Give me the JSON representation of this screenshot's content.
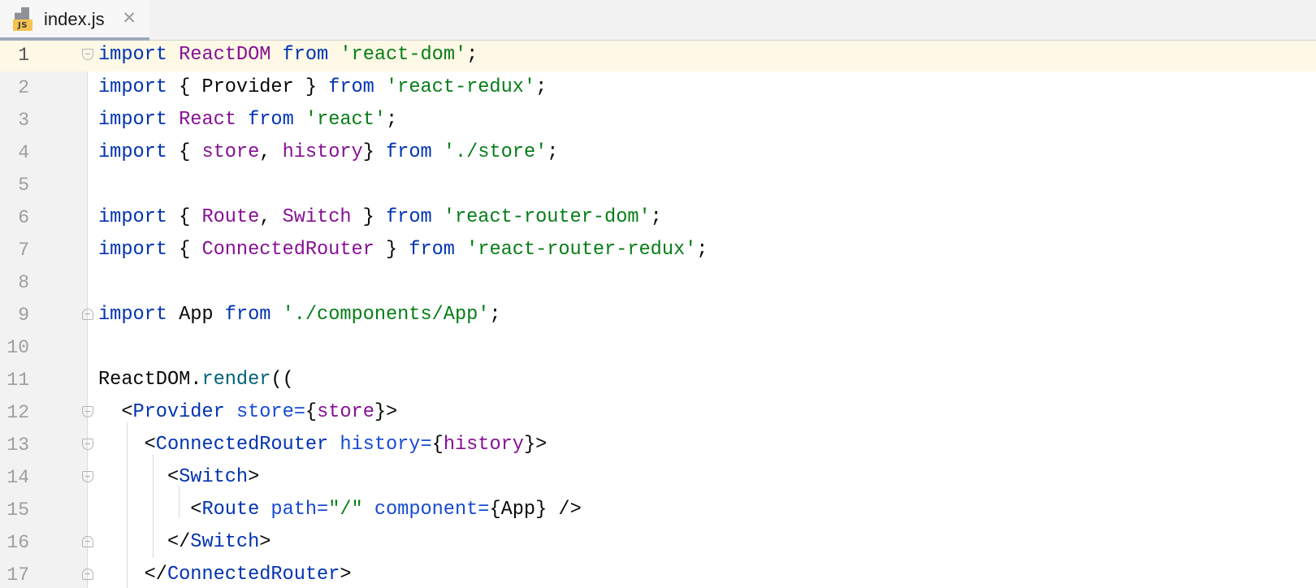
{
  "tab": {
    "icon_badge": "JS",
    "title": "index.js",
    "close_glyph": "✕"
  },
  "editor": {
    "current_line": 1,
    "lines": [
      {
        "number": "1",
        "fold": "open",
        "tokens": [
          [
            "kw",
            "import"
          ],
          [
            "plain",
            " "
          ],
          [
            "imp",
            "ReactDOM"
          ],
          [
            "plain",
            " "
          ],
          [
            "kw",
            "from"
          ],
          [
            "plain",
            " "
          ],
          [
            "str",
            "'react-dom'"
          ],
          [
            "plain",
            ";"
          ]
        ]
      },
      {
        "number": "2",
        "fold": "",
        "tokens": [
          [
            "kw",
            "import"
          ],
          [
            "plain",
            " { Provider } "
          ],
          [
            "kw",
            "from"
          ],
          [
            "plain",
            " "
          ],
          [
            "str",
            "'react-redux'"
          ],
          [
            "plain",
            ";"
          ]
        ]
      },
      {
        "number": "3",
        "fold": "",
        "tokens": [
          [
            "kw",
            "import"
          ],
          [
            "plain",
            " "
          ],
          [
            "imp",
            "React"
          ],
          [
            "plain",
            " "
          ],
          [
            "kw",
            "from"
          ],
          [
            "plain",
            " "
          ],
          [
            "str",
            "'react'"
          ],
          [
            "plain",
            ";"
          ]
        ]
      },
      {
        "number": "4",
        "fold": "",
        "tokens": [
          [
            "kw",
            "import"
          ],
          [
            "plain",
            " { "
          ],
          [
            "imp",
            "store"
          ],
          [
            "plain",
            ", "
          ],
          [
            "imp",
            "history"
          ],
          [
            "plain",
            "} "
          ],
          [
            "kw",
            "from"
          ],
          [
            "plain",
            " "
          ],
          [
            "str",
            "'./store'"
          ],
          [
            "plain",
            ";"
          ]
        ]
      },
      {
        "number": "5",
        "fold": "",
        "tokens": []
      },
      {
        "number": "6",
        "fold": "",
        "tokens": [
          [
            "kw",
            "import"
          ],
          [
            "plain",
            " { "
          ],
          [
            "imp",
            "Route"
          ],
          [
            "plain",
            ", "
          ],
          [
            "imp",
            "Switch"
          ],
          [
            "plain",
            " } "
          ],
          [
            "kw",
            "from"
          ],
          [
            "plain",
            " "
          ],
          [
            "str",
            "'react-router-dom'"
          ],
          [
            "plain",
            ";"
          ]
        ]
      },
      {
        "number": "7",
        "fold": "",
        "tokens": [
          [
            "kw",
            "import"
          ],
          [
            "plain",
            " { "
          ],
          [
            "imp",
            "ConnectedRouter"
          ],
          [
            "plain",
            " } "
          ],
          [
            "kw",
            "from"
          ],
          [
            "plain",
            " "
          ],
          [
            "str",
            "'react-router-redux'"
          ],
          [
            "plain",
            ";"
          ]
        ]
      },
      {
        "number": "8",
        "fold": "",
        "tokens": []
      },
      {
        "number": "9",
        "fold": "close",
        "tokens": [
          [
            "kw",
            "import"
          ],
          [
            "plain",
            " App "
          ],
          [
            "kw",
            "from"
          ],
          [
            "plain",
            " "
          ],
          [
            "str",
            "'./components/App'"
          ],
          [
            "plain",
            ";"
          ]
        ]
      },
      {
        "number": "10",
        "fold": "",
        "tokens": []
      },
      {
        "number": "11",
        "fold": "",
        "tokens": [
          [
            "plain",
            "ReactDOM."
          ],
          [
            "fn",
            "render"
          ],
          [
            "plain",
            "(("
          ]
        ]
      },
      {
        "number": "12",
        "fold": "open",
        "tokens": [
          [
            "plain",
            "  <"
          ],
          [
            "tag",
            "Provider"
          ],
          [
            "plain",
            " "
          ],
          [
            "attr",
            "store="
          ],
          [
            "plain",
            "{"
          ],
          [
            "imp",
            "store"
          ],
          [
            "plain",
            "}>"
          ]
        ]
      },
      {
        "number": "13",
        "fold": "open",
        "tokens": [
          [
            "plain",
            "    <"
          ],
          [
            "tag",
            "ConnectedRouter"
          ],
          [
            "plain",
            " "
          ],
          [
            "attr",
            "history="
          ],
          [
            "plain",
            "{"
          ],
          [
            "imp",
            "history"
          ],
          [
            "plain",
            "}>"
          ]
        ]
      },
      {
        "number": "14",
        "fold": "open",
        "tokens": [
          [
            "plain",
            "      <"
          ],
          [
            "tag",
            "Switch"
          ],
          [
            "plain",
            ">"
          ]
        ]
      },
      {
        "number": "15",
        "fold": "",
        "tokens": [
          [
            "plain",
            "        <"
          ],
          [
            "tag",
            "Route"
          ],
          [
            "plain",
            " "
          ],
          [
            "attr",
            "path="
          ],
          [
            "str",
            "\"/\""
          ],
          [
            "plain",
            " "
          ],
          [
            "attr",
            "component="
          ],
          [
            "plain",
            "{App} />"
          ]
        ]
      },
      {
        "number": "16",
        "fold": "close",
        "tokens": [
          [
            "plain",
            "      </"
          ],
          [
            "tag",
            "Switch"
          ],
          [
            "plain",
            ">"
          ]
        ]
      },
      {
        "number": "17",
        "fold": "close",
        "tokens": [
          [
            "plain",
            "    </"
          ],
          [
            "tag",
            "ConnectedRouter"
          ],
          [
            "plain",
            ">"
          ]
        ]
      }
    ]
  }
}
